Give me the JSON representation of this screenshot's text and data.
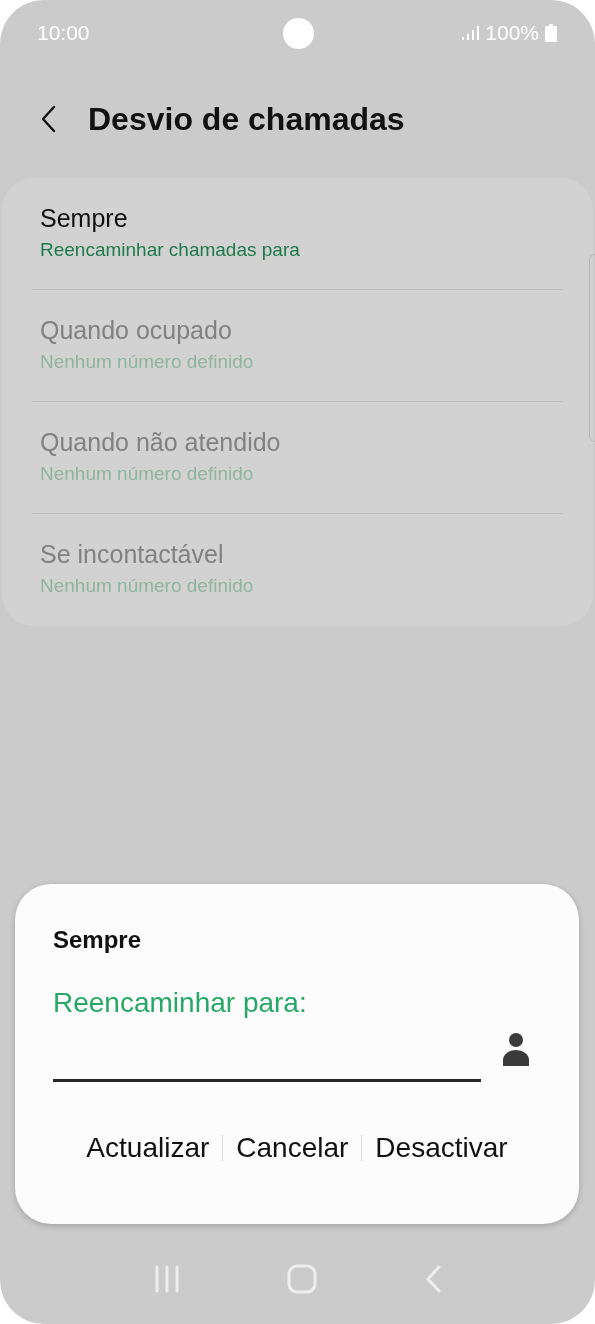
{
  "status_bar": {
    "time": "10:00",
    "battery": "100%"
  },
  "header": {
    "title": "Desvio de chamadas"
  },
  "items": [
    {
      "title": "Sempre",
      "subtitle": "Reencaminhar chamadas para",
      "disabled": false
    },
    {
      "title": "Quando ocupado",
      "subtitle": "Nenhum número definido",
      "disabled": true
    },
    {
      "title": "Quando não atendido",
      "subtitle": "Nenhum número definido",
      "disabled": true
    },
    {
      "title": "Se incontactável",
      "subtitle": "Nenhum número definido",
      "disabled": true
    }
  ],
  "dialog": {
    "title": "Sempre",
    "label": "Reencaminhar para:",
    "buttons": [
      "Actualizar",
      "Cancelar",
      "Desactivar"
    ]
  }
}
